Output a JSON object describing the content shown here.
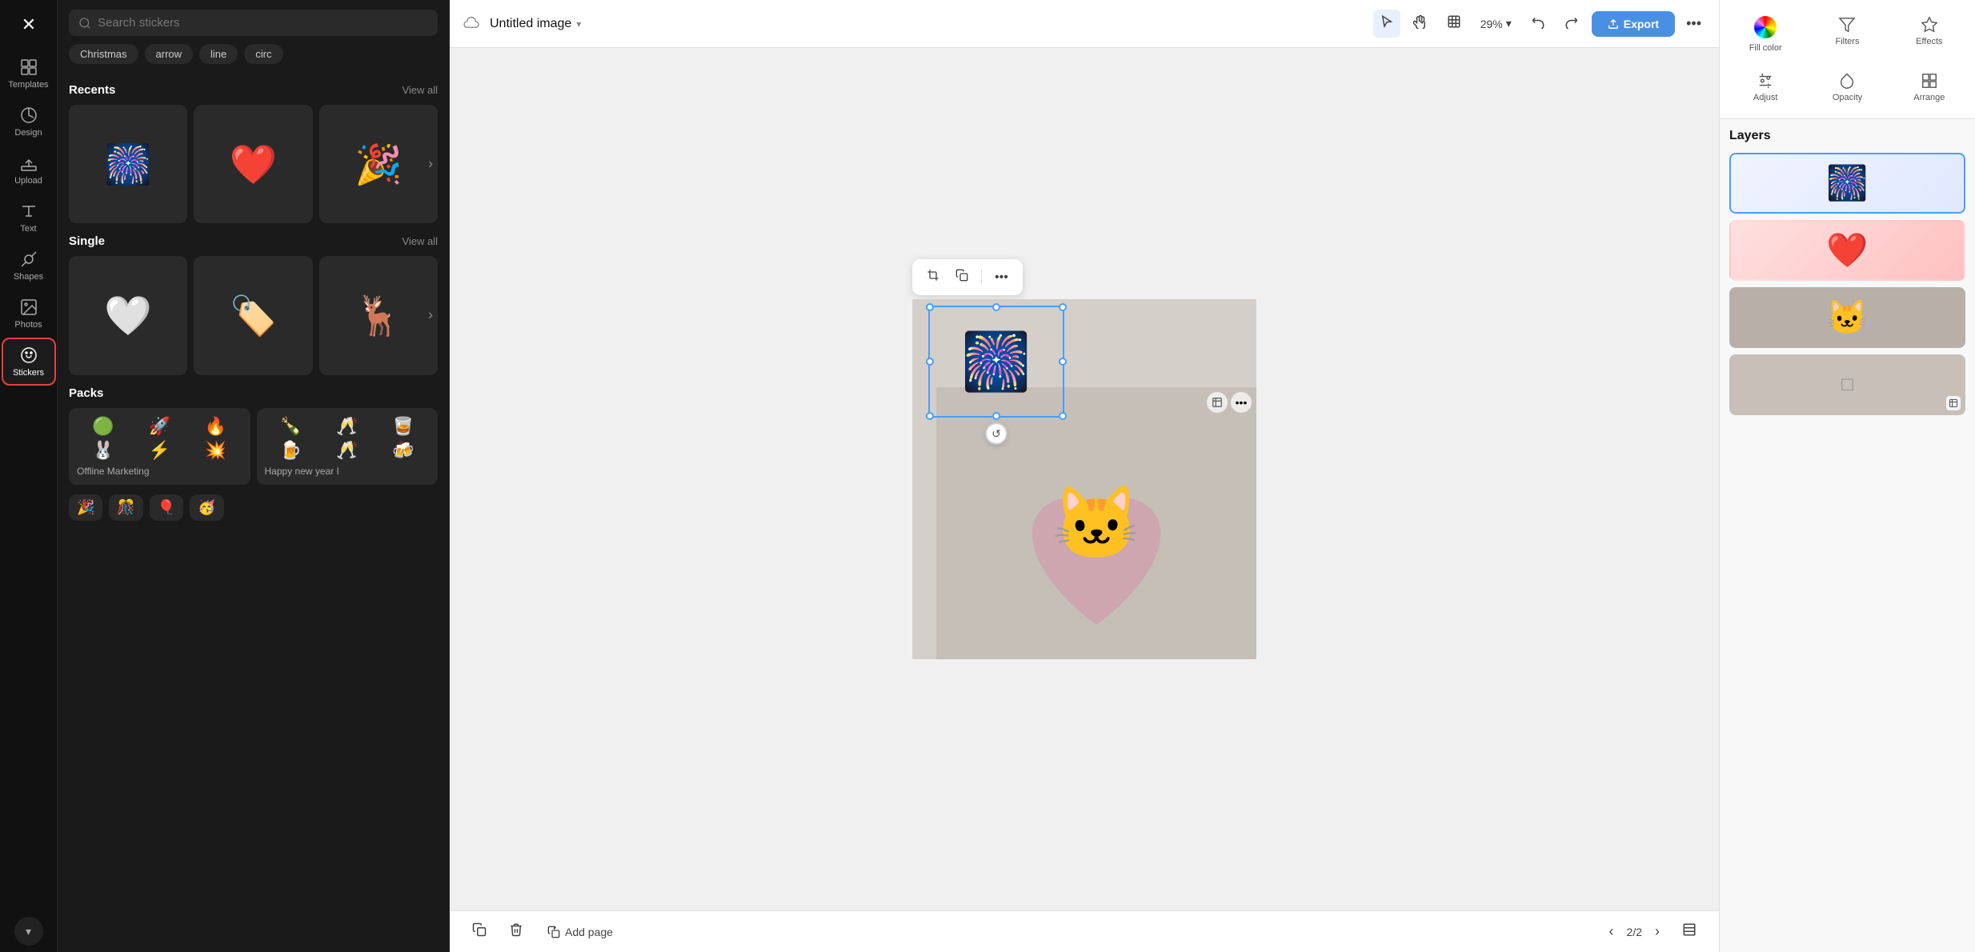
{
  "app": {
    "logo": "✕",
    "title": "Untitled image"
  },
  "sidebar": {
    "items": [
      {
        "id": "templates",
        "label": "Templates",
        "icon": "template"
      },
      {
        "id": "design",
        "label": "Design",
        "icon": "design"
      },
      {
        "id": "upload",
        "label": "Upload",
        "icon": "upload"
      },
      {
        "id": "text",
        "label": "Text",
        "icon": "text"
      },
      {
        "id": "shapes",
        "label": "Shapes",
        "icon": "shapes"
      },
      {
        "id": "photos",
        "label": "Photos",
        "icon": "photos"
      },
      {
        "id": "stickers",
        "label": "Stickers",
        "icon": "stickers"
      }
    ]
  },
  "stickers_panel": {
    "search_placeholder": "Search stickers",
    "tags": [
      "Christmas",
      "arrow",
      "line",
      "circ"
    ],
    "sections": {
      "recents": {
        "title": "Recents",
        "view_all": "View all"
      },
      "single": {
        "title": "Single",
        "view_all": "View all"
      },
      "packs": {
        "title": "Packs"
      }
    },
    "packs": [
      {
        "name": "Offline Marketing",
        "icons": [
          "🟢",
          "🚀",
          "🔥",
          "🐰",
          "⚡",
          "💥"
        ]
      },
      {
        "name": "Happy new year I",
        "icons": [
          "🍾",
          "🥂",
          "🥃",
          "🍺",
          "🍻",
          "🥃"
        ]
      }
    ]
  },
  "topbar": {
    "zoom": "29%",
    "export_label": "Export",
    "more": "..."
  },
  "canvas_toolbar": {
    "crop": "⊡",
    "duplicate": "⧉",
    "more": "..."
  },
  "bottom_bar": {
    "add_page": "Add page",
    "page_current": "2",
    "page_total": "2"
  },
  "right_panel": {
    "fill_color_label": "Fill color",
    "filters_label": "Filters",
    "effects_label": "Effects",
    "adjust_label": "Adjust",
    "opacity_label": "Opacity",
    "arrange_label": "Arrange"
  },
  "layers": {
    "title": "Layers"
  }
}
